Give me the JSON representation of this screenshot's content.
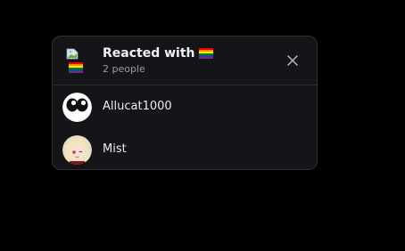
{
  "dialog": {
    "title": "Reacted with",
    "reaction_icon": "rainbow-flag-emoji",
    "subtitle": "2 people",
    "close_icon": "close-icon"
  },
  "users": [
    {
      "name": "Allucat1000",
      "avatar": "cartoon-eyes-avatar"
    },
    {
      "name": "Mist",
      "avatar": "anime-girl-avatar"
    }
  ],
  "colors": {
    "background": "#000000",
    "dialog": "#151519",
    "border": "#2e2e35",
    "text": "#f2f2f4",
    "muted": "#9a9aa3"
  }
}
